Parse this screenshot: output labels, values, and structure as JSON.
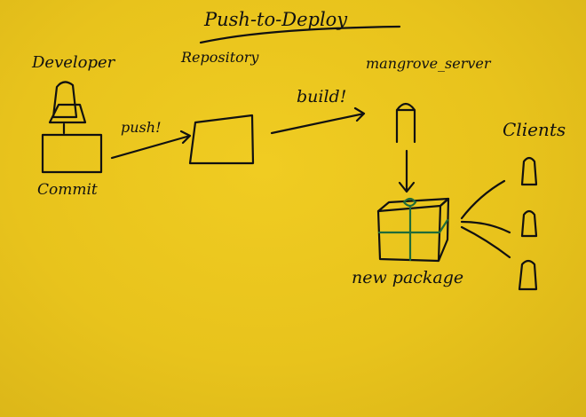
{
  "title": "Push-to-Deploy",
  "labels": {
    "developer": "Developer",
    "repository": "Repository",
    "server": "mangrove_server",
    "clients": "Clients",
    "commit": "Commit",
    "push": "push!",
    "build": "build!",
    "package": "new package"
  },
  "colors": {
    "paper": "#e8c31c",
    "ink": "#111111",
    "ribbon": "#1f6b3a"
  }
}
